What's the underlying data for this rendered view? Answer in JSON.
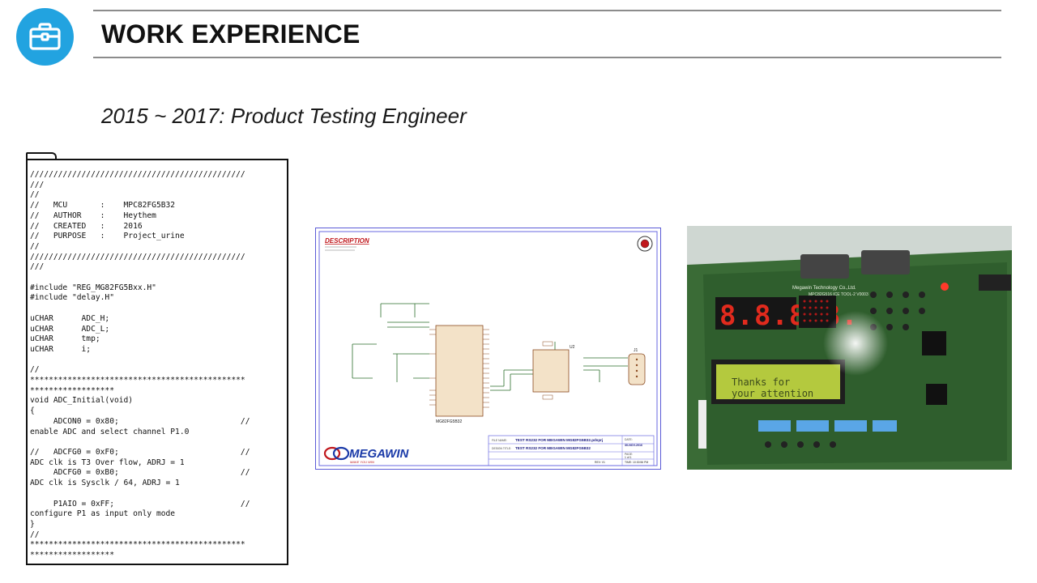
{
  "header": {
    "title": "WORK EXPERIENCE",
    "icon": "briefcase-icon",
    "accent_color": "#22a3e0"
  },
  "subtitle": "2015 ~ 2017: Product Testing Engineer",
  "code_panel": {
    "lines": [
      "//////////////////////////////////////////////",
      "///",
      "//",
      "//   MCU       :    MPC82FG5B32",
      "//   AUTHOR    :    Heythem",
      "//   CREATED   :    2016",
      "//   PURPOSE   :    Project_urine",
      "//",
      "//////////////////////////////////////////////",
      "///",
      "",
      "#include \"REG_MG82FG5Bxx.H\"",
      "#include \"delay.H\"",
      "",
      "uCHAR      ADC_H;",
      "uCHAR      ADC_L;",
      "uCHAR      tmp;",
      "uCHAR      i;",
      "",
      "//",
      "**********************************************",
      "******************",
      "void ADC_Initial(void)",
      "{",
      "     ADCON0 = 0x80;                          //",
      "enable ADC and select channel P1.0",
      "",
      "//   ADCFG0 = 0xF0;                          //",
      "ADC clk is T3 Over flow, ADRJ = 1",
      "     ADCFG0 = 0xB0;                          //",
      "ADC clk is Sysclk / 64, ADRJ = 1",
      "",
      "     P1AIO = 0xFF;                           //",
      "configure P1 as input only mode",
      "}",
      "//",
      "**********************************************",
      "******************"
    ]
  },
  "schematic": {
    "description_label": "DESCRIPTION",
    "logo_text": "MEGAWIN",
    "logo_tagline": "MAKE YOU WIN",
    "chip_u1": "MG82FG5B32",
    "chip_u2_label": "U2",
    "connector_label": "J1",
    "file_name_label": "FILE NAME:",
    "file_name": "TEST RS232 FOR MEGAWIN MG82FG5B32.pdsprj",
    "design_title_label": "DESIGN TITLE:",
    "design_title": "TEST RS232 FOR MEGAWIN MG82FG5B32",
    "date_label": "DATE:",
    "date": "30-NOV-2016",
    "page_label": "PAGE:",
    "page": "1  of  1",
    "rev": "REV: V1",
    "time": "TIME: 10:30:56 PM"
  },
  "board_photo": {
    "lcd_line1": "Thanks for",
    "lcd_line2": " your attention",
    "seven_segment": "8.8.8.8.",
    "board_label": "Megawin Technology Co.,Ltd.",
    "board_model": "MPC82G516 ICE TOOL-2 V0003"
  }
}
